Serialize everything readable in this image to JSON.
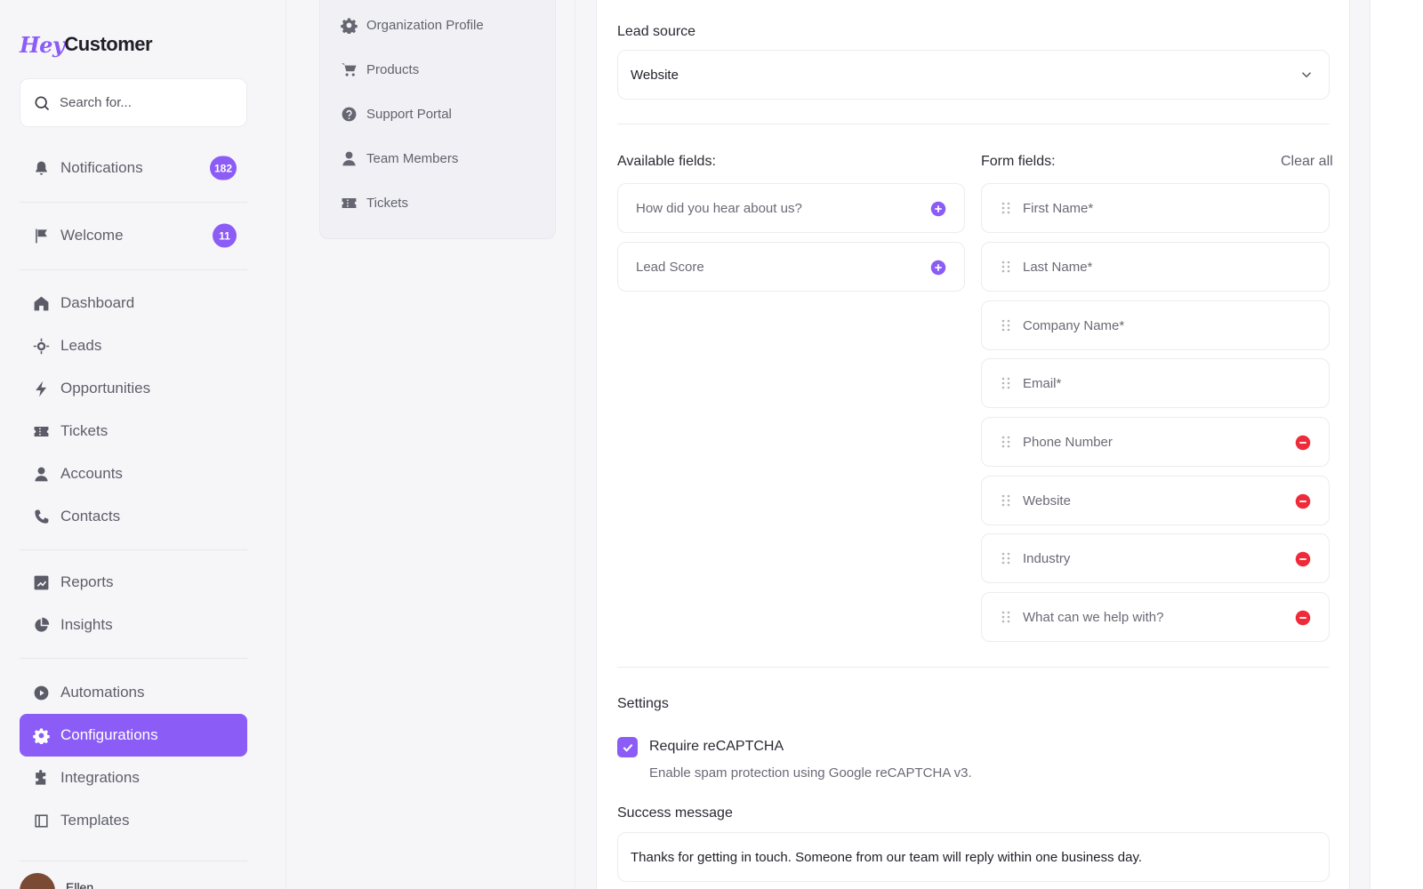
{
  "brand": {
    "logo_hey": "Hey",
    "logo_customer": "Customer"
  },
  "search": {
    "placeholder": "Search for..."
  },
  "sidebar": {
    "notifications": {
      "label": "Notifications",
      "count": "182"
    },
    "welcome": {
      "label": "Welcome",
      "count": "11"
    },
    "items": [
      {
        "label": "Dashboard",
        "icon": "home-icon"
      },
      {
        "label": "Leads",
        "icon": "target-icon"
      },
      {
        "label": "Opportunities",
        "icon": "bolt-icon"
      },
      {
        "label": "Tickets",
        "icon": "ticket-icon"
      },
      {
        "label": "Accounts",
        "icon": "user-icon"
      },
      {
        "label": "Contacts",
        "icon": "phone-icon"
      },
      {
        "label": "Reports",
        "icon": "chart-icon"
      },
      {
        "label": "Insights",
        "icon": "pie-icon"
      },
      {
        "label": "Automations",
        "icon": "play-icon"
      },
      {
        "label": "Configurations",
        "icon": "gear-icon",
        "active": true
      },
      {
        "label": "Integrations",
        "icon": "puzzle-icon"
      },
      {
        "label": "Templates",
        "icon": "template-icon"
      }
    ],
    "user": {
      "name": "Ellen"
    }
  },
  "config_menu": {
    "items": [
      {
        "label": "Organization Profile",
        "icon": "gear-icon"
      },
      {
        "label": "Products",
        "icon": "cart-icon"
      },
      {
        "label": "Support Portal",
        "icon": "help-icon"
      },
      {
        "label": "Team Members",
        "icon": "user-icon"
      },
      {
        "label": "Tickets",
        "icon": "ticket-icon"
      }
    ]
  },
  "form": {
    "lead_source_label": "Lead source",
    "lead_source_value": "Website",
    "available_label": "Available fields:",
    "form_fields_label": "Form fields:",
    "clear_all": "Clear all",
    "available_fields": [
      "How did you hear about us?",
      "Lead Score"
    ],
    "form_fields": [
      {
        "label": "First Name*",
        "removable": false
      },
      {
        "label": "Last Name*",
        "removable": false
      },
      {
        "label": "Company Name*",
        "removable": false
      },
      {
        "label": "Email*",
        "removable": false
      },
      {
        "label": "Phone Number",
        "removable": true
      },
      {
        "label": "Website",
        "removable": true
      },
      {
        "label": "Industry",
        "removable": true
      },
      {
        "label": "What can we help with?",
        "removable": true
      }
    ],
    "settings_label": "Settings",
    "recaptcha_label": "Require reCAPTCHA",
    "recaptcha_help": "Enable spam protection using Google reCAPTCHA v3.",
    "recaptcha_checked": true,
    "success_label": "Success message",
    "success_value": "Thanks for getting in touch. Someone from our team will reply within one business day."
  },
  "colors": {
    "accent": "#8b5cf6",
    "remove": "#ef2b3a"
  }
}
